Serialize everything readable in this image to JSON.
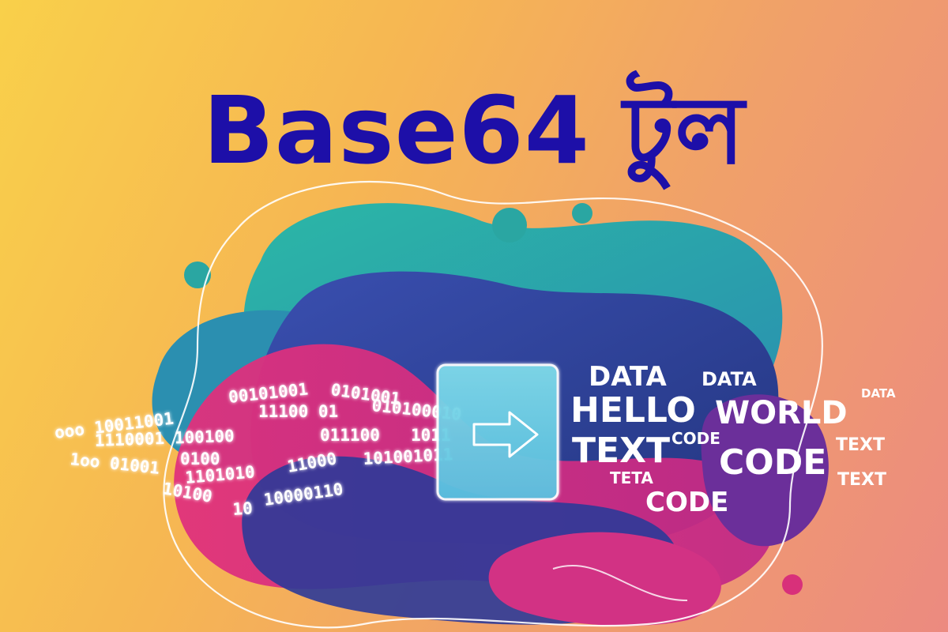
{
  "title": "Base64 টুল",
  "binary_lines": [
    "1110001 100100",
    "00101001",
    "ooo 10011001",
    "11100 01",
    "0101001",
    "010100010",
    "011100",
    "1011",
    "1oo 01001",
    "0100",
    "1101010",
    "11000",
    "101001011",
    "10000110",
    "10100",
    "10"
  ],
  "words": [
    "DATA",
    "DATA",
    "DATA",
    "HELLO",
    "WORLD",
    "TEXT",
    "CODE",
    "CODE",
    "TEXT",
    "TEXT",
    "TETA",
    "CODE"
  ],
  "icon": "arrow-right-icon",
  "colors": {
    "title": "#1d0fa8",
    "teal": "#22aaa5",
    "blue": "#2a3f9e",
    "magenta": "#d2307a",
    "purple": "#6b2f9a"
  }
}
